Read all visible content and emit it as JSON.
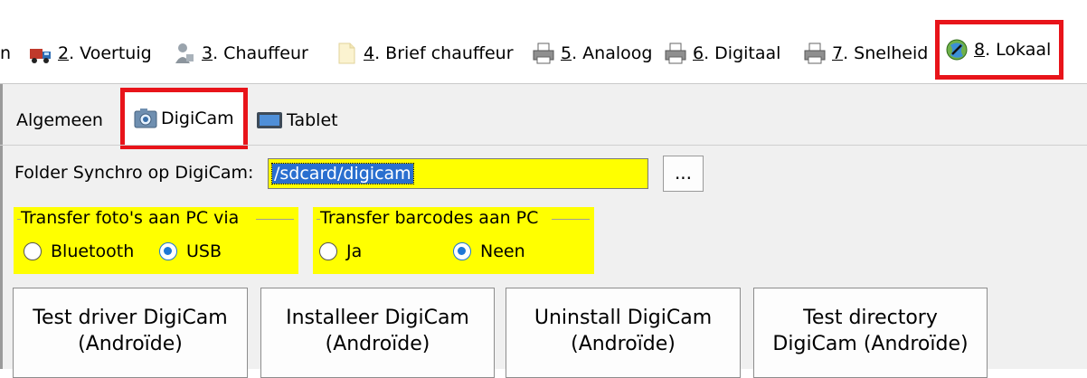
{
  "top_tabs": [
    {
      "prefix": "",
      "label": "n",
      "icon": "partial-tab"
    },
    {
      "prefix": "2",
      "label": ". Voertuig",
      "icon": "truck-icon"
    },
    {
      "prefix": "3",
      "label": ". Chauffeur",
      "icon": "driver-icon"
    },
    {
      "prefix": "4",
      "label": ". Brief chauffeur",
      "icon": "letter-icon"
    },
    {
      "prefix": "5",
      "label": ". Analoog",
      "icon": "printer-icon"
    },
    {
      "prefix": "6",
      "label": ". Digitaal",
      "icon": "printer-icon"
    },
    {
      "prefix": "7",
      "label": ". Snelheid",
      "icon": "printer-icon"
    },
    {
      "prefix": "8",
      "label": ". Lokaal",
      "icon": "local-icon",
      "active": true
    }
  ],
  "sub_tabs": [
    {
      "label": "Algemeen"
    },
    {
      "label": "DigiCam",
      "icon": "camera-icon",
      "active": true
    },
    {
      "label": "Tablet",
      "icon": "tablet-icon"
    }
  ],
  "folder": {
    "label": "Folder Synchro op DigiCam:",
    "value": "/sdcard/digicam",
    "browse_label": "..."
  },
  "transfer_photos": {
    "title": "Transfer foto's aan PC via",
    "options": [
      "Bluetooth",
      "USB"
    ],
    "selected": "USB"
  },
  "transfer_barcodes": {
    "title": "Transfer barcodes aan PC",
    "options": [
      "Ja",
      "Neen"
    ],
    "selected": "Neen"
  },
  "buttons": [
    {
      "line1": "Test driver DigiCam",
      "line2": "(Androïde)"
    },
    {
      "line1": "Installeer DigiCam",
      "line2": "(Androïde)"
    },
    {
      "line1": "Uninstall DigiCam",
      "line2": "(Androïde)"
    },
    {
      "line1": "Test directory",
      "line2": "DigiCam (Androïde)"
    }
  ],
  "colors": {
    "highlight_border": "#e8141a",
    "field_yellow": "#ffff00",
    "selection_blue": "#2a6fcf",
    "radio_blue": "#1e78d6"
  }
}
